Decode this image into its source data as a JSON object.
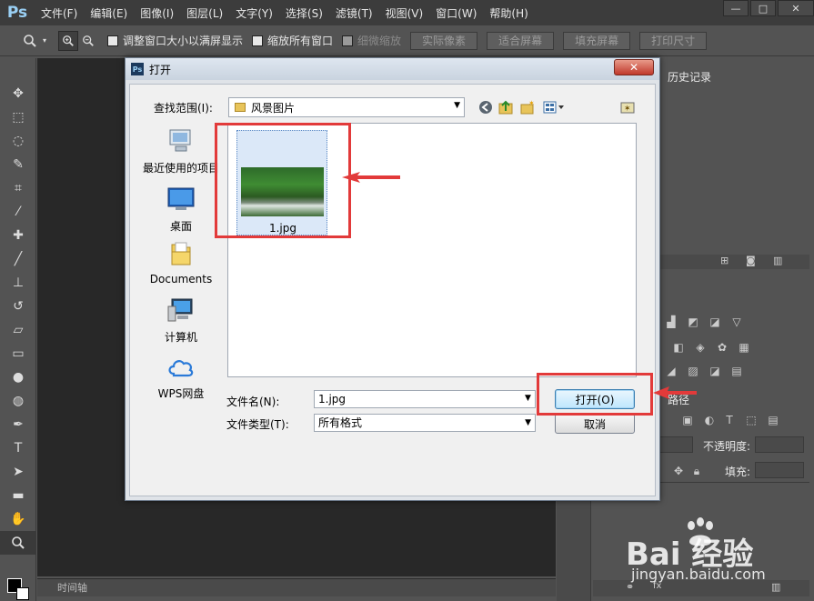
{
  "app": {
    "logo": "Ps"
  },
  "menu": [
    "文件(F)",
    "编辑(E)",
    "图像(I)",
    "图层(L)",
    "文字(Y)",
    "选择(S)",
    "滤镜(T)",
    "视图(V)",
    "窗口(W)",
    "帮助(H)"
  ],
  "window_controls": {
    "minimize": "—",
    "maximize": "□",
    "close": "✕"
  },
  "options_bar": {
    "resize_windows": "调整窗口大小以满屏显示",
    "zoom_all": "缩放所有窗口",
    "scrubby_zoom": "细微缩放",
    "actual_pixels": "实际像素",
    "fit_screen": "适合屏幕",
    "fill_screen": "填充屏幕",
    "print_size": "打印尺寸"
  },
  "panels": {
    "history_tab": "历史记录",
    "paths_tab": "路径",
    "opacity_label": "不透明度:",
    "fill_label": "填充:",
    "timeline_tab": "时间轴"
  },
  "dialog": {
    "title": "打开",
    "close": "✕",
    "look_in_label": "查找范围(I):",
    "look_in_value": "风景图片",
    "places": [
      "最近使用的项目",
      "桌面",
      "Documents",
      "计算机",
      "WPS网盘"
    ],
    "file_name": "1.jpg",
    "file_name_label": "文件名(N):",
    "file_name_value": "1.jpg",
    "file_type_label": "文件类型(T):",
    "file_type_value": "所有格式",
    "open_button": "打开(O)",
    "cancel_button": "取消"
  },
  "watermark": {
    "logo": "Bai  经验",
    "url": "jingyan.baidu.com"
  },
  "colors": {
    "annotation_red": "#e23a3a",
    "ps_dark": "#535353",
    "canvas": "#282828"
  }
}
